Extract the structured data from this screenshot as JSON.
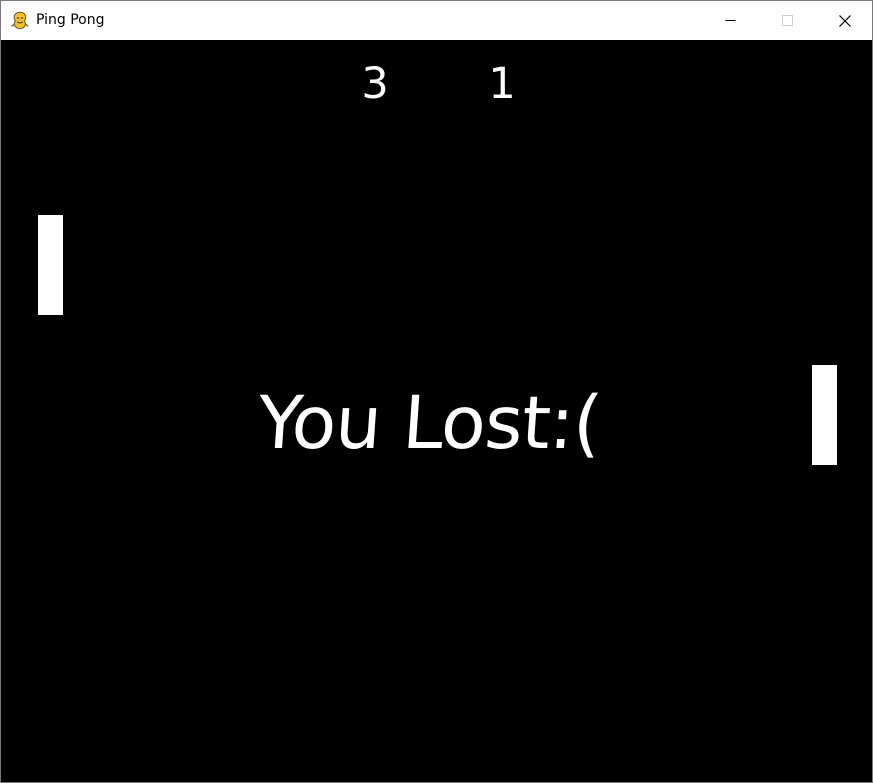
{
  "window": {
    "title": "Ping Pong",
    "icon": "pygame-snake-icon",
    "controls": [
      "minimize-icon",
      "maximize-icon",
      "close-icon"
    ]
  },
  "game": {
    "scores": {
      "left": "3",
      "right": "1"
    },
    "message": "You Lost:(",
    "colors": {
      "background": "#000000",
      "foreground": "#ffffff"
    }
  }
}
